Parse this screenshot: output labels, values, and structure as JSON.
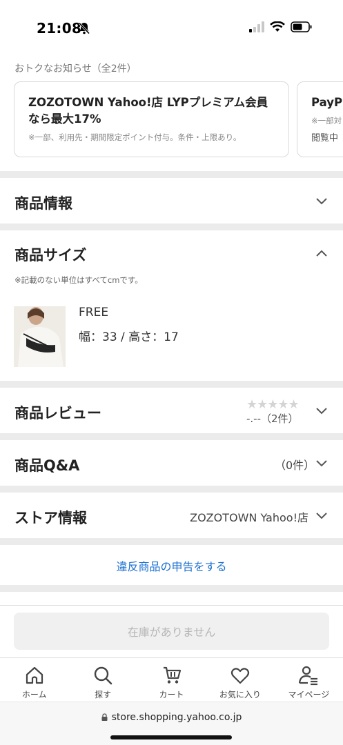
{
  "status_bar": {
    "time": "21:08"
  },
  "notices": {
    "label": "おトクなお知らせ（全2件）",
    "cards": [
      {
        "title": "ZOZOTOWN Yahoo!店 LYPプレミアム会員なら最大17%",
        "sub": "※一部、利用先・期間限定ポイント付与。条件・上限あり。"
      },
      {
        "title": "PayP",
        "sub": "※一部対",
        "sub2": "閲覧中"
      }
    ]
  },
  "sections": {
    "product_info": {
      "title": "商品情報"
    },
    "product_size": {
      "title": "商品サイズ",
      "note": "※記載のない単位はすべてcmです。",
      "size_name": "FREE",
      "size_dims": "幅：33 / 高さ：17"
    },
    "reviews": {
      "title": "商品レビュー",
      "stars": "★★★★★",
      "rating": 0,
      "rating_text": "-.--（2件）"
    },
    "qa": {
      "title": "商品Q&A",
      "count": "（0件）"
    },
    "store": {
      "title": "ストア情報",
      "store_name": "ZOZOTOWN Yahoo!店"
    }
  },
  "report_link": "違反商品の申告をする",
  "stock_button": "在庫がありません",
  "tab_bar": [
    {
      "label": "ホーム",
      "icon": "home-icon"
    },
    {
      "label": "探す",
      "icon": "search-icon"
    },
    {
      "label": "カート",
      "icon": "cart-icon"
    },
    {
      "label": "お気に入り",
      "icon": "heart-icon"
    },
    {
      "label": "マイページ",
      "icon": "user-icon"
    }
  ],
  "url_bar": {
    "url": "store.shopping.yahoo.co.jp"
  },
  "colors": {
    "link": "#1a6fd0",
    "separator": "#ebebeb",
    "disabled_text": "#b6b6b6"
  }
}
